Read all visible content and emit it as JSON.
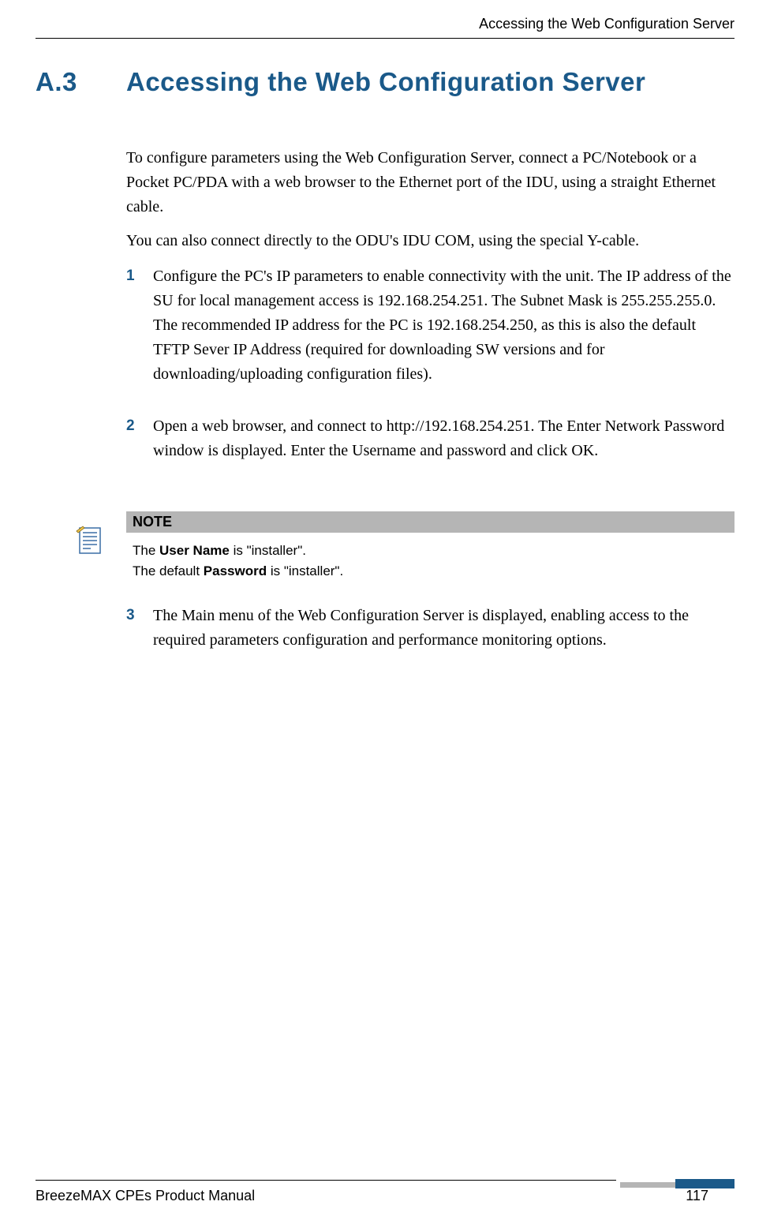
{
  "header": {
    "running_title": "Accessing the Web Configuration Server"
  },
  "section": {
    "number": "A.3",
    "title": "Accessing the Web Configuration Server"
  },
  "paragraphs": {
    "p1": "To configure parameters using the Web Configuration Server, connect a PC/Notebook or a Pocket PC/PDA with a web browser to the Ethernet port of the IDU, using a straight Ethernet cable.",
    "p2": "You can also connect directly to the ODU's IDU COM, using the special Y-cable."
  },
  "steps": {
    "s1_num": "1",
    "s1_text": "Configure the PC's IP parameters to enable connectivity with the unit. The IP address of the SU for local management access is 192.168.254.251. The Subnet Mask is 255.255.255.0. The recommended IP address for the PC is 192.168.254.250, as this is also the default TFTP Sever IP Address (required for downloading SW versions and for downloading/uploading configuration files).",
    "s2_num": "2",
    "s2_text": "Open a web browser, and connect to http://192.168.254.251. The Enter Network Password window is displayed. Enter the Username and password and click OK.",
    "s3_num": "3",
    "s3_text": "The Main menu of the Web Configuration Server is displayed, enabling access to the required parameters configuration and performance monitoring options."
  },
  "note": {
    "header": "NOTE",
    "line1_prefix": "The ",
    "line1_bold": "User Name",
    "line1_suffix": " is \"installer\".",
    "line2_prefix": "The default ",
    "line2_bold": "Password",
    "line2_suffix": " is \"installer\"."
  },
  "footer": {
    "manual_name": "BreezeMAX CPEs Product Manual",
    "page_number": "117"
  }
}
